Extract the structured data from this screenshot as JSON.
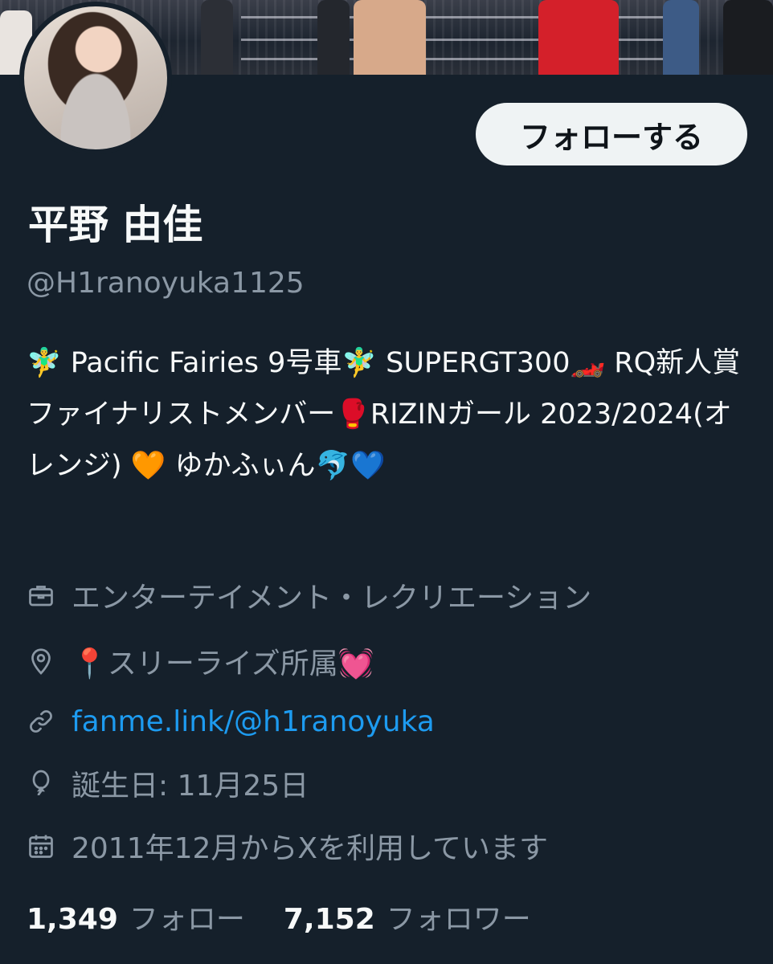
{
  "profile": {
    "follow_button": "フォローする",
    "name": "平野 由佳",
    "handle": "@H1ranoyuka1125",
    "bio": "🧚‍♂️ Pacific Fairies 9号車🧚‍♂️ SUPERGT300🏎️ RQ新人賞ファイナリストメンバー🥊RIZINガール 2023/2024(オレンジ) 🧡 ゆかふぃん🐬💙"
  },
  "meta": {
    "category": "エンターテイメント・レクリエーション",
    "location": "📍スリーライズ所属💓",
    "link": "fanme.link/@h1ranoyuka",
    "birthday": "誕生日: 11月25日",
    "joined": "2011年12月からXを利用しています"
  },
  "stats": {
    "following_count": "1,349",
    "following_label": "フォロー",
    "followers_count": "7,152",
    "followers_label": "フォロワー"
  },
  "colors": {
    "background": "#15202b",
    "text_primary": "#f7f9f9",
    "text_secondary": "#8b98a5",
    "link": "#1d9bf0",
    "button_bg": "#eff3f4"
  },
  "icons": {
    "category": "briefcase-icon",
    "location": "location-pin-icon",
    "link": "link-icon",
    "birthday": "balloon-icon",
    "joined": "calendar-icon"
  }
}
